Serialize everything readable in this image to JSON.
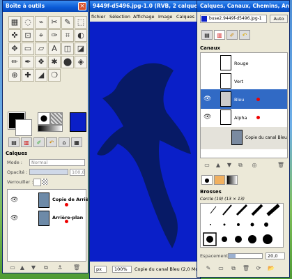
{
  "toolbox": {
    "title": "Boîte à outils",
    "layers_title": "Calques",
    "mode_label": "Mode :",
    "mode_value": "Normal",
    "opacity_label": "Opacité :",
    "opacity_value": "100,0",
    "lock_label": "Verrouiller :",
    "layers": [
      {
        "name": "Copie de Arrière"
      },
      {
        "name": "Arrière-plan"
      }
    ]
  },
  "image_window": {
    "title": "9449f-d5496.jpg-1.0 (RVB, 2 calques",
    "menus": [
      "fichier",
      "Sélection",
      "Affichage",
      "Image",
      "Calques"
    ],
    "zoom": "100%",
    "unit": "px",
    "status": "Copie du canal Bleu (2,0 Mo"
  },
  "dock": {
    "title": "Calques, Canaux, Chemins, Ann...",
    "image_selector": "buse2.9449f-d5496.jpg-1",
    "auto_label": "Auto",
    "channels_title": "Canaux",
    "channels": [
      {
        "name": "Rouge"
      },
      {
        "name": "Vert"
      },
      {
        "name": "Bleu"
      },
      {
        "name": "Alpha"
      },
      {
        "name": "Copie du canal Bleu"
      }
    ],
    "brushes_title": "Brosses",
    "brush_name": "Cercle (19) (13 × 13)",
    "spacing_label": "Espacement :",
    "spacing_value": "20,0"
  },
  "colors": {
    "accent": "#0a5ad6",
    "canvas": "#0a1fc8",
    "selected_row": "#316ac5"
  }
}
